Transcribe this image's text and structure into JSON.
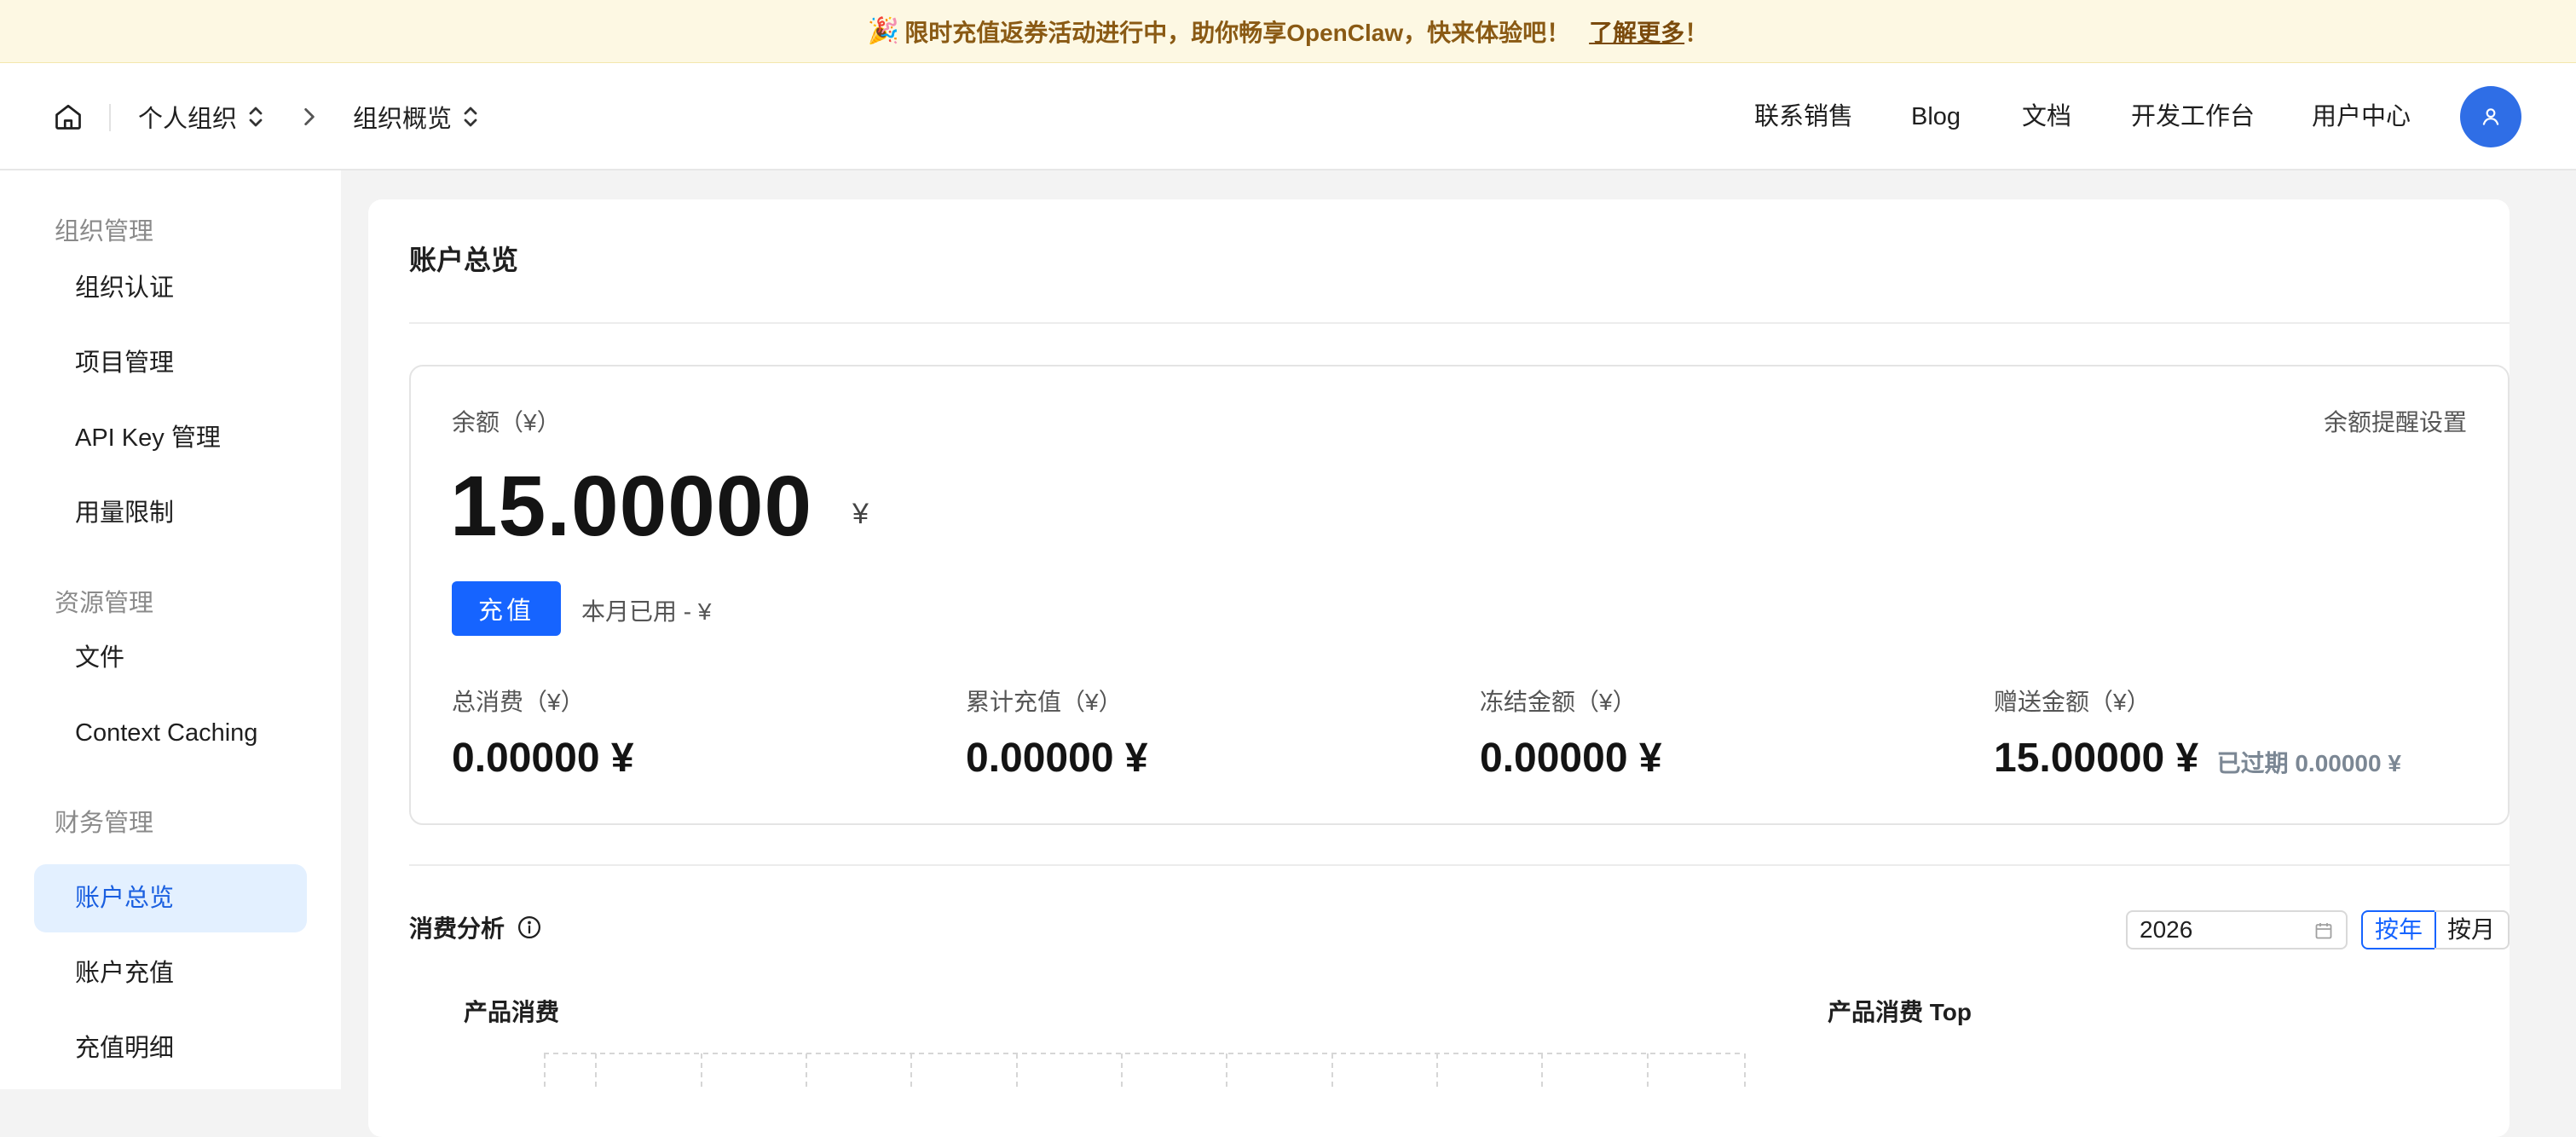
{
  "banner": {
    "icon": "party-popper-icon",
    "text": "限时充值返券活动进行中，助你畅享OpenClaw，快来体验吧！",
    "link": "了解更多",
    "tail": "！"
  },
  "nav": {
    "org": "个人组织",
    "page": "组织概览",
    "links": [
      "联系销售",
      "Blog",
      "文档",
      "开发工作台",
      "用户中心"
    ]
  },
  "sidebar": {
    "groups": [
      {
        "title": "组织管理",
        "items": [
          "组织认证",
          "项目管理",
          "API Key 管理",
          "用量限制"
        ]
      },
      {
        "title": "资源管理",
        "items": [
          "文件",
          "Context Caching"
        ]
      },
      {
        "title": "财务管理",
        "items": [
          "账户总览",
          "账户充值",
          "充值明细"
        ]
      }
    ],
    "active": "账户总览"
  },
  "main": {
    "title": "账户总览",
    "balance": {
      "label": "余额（¥）",
      "remind": "余额提醒设置",
      "amount": "15.00000",
      "unit": "¥",
      "recharge": "充值",
      "month_used": "本月已用 - ¥"
    },
    "stats": [
      {
        "label": "总消费（¥）",
        "value": "0.00000 ¥"
      },
      {
        "label": "累计充值（¥）",
        "value": "0.00000 ¥"
      },
      {
        "label": "冻结金额（¥）",
        "value": "0.00000 ¥"
      },
      {
        "label": "赠送金额（¥）",
        "value": "15.00000 ¥",
        "extra": "已过期 0.00000 ¥"
      }
    ],
    "analysis": {
      "title": "消费分析",
      "year": "2026",
      "by_year": "按年",
      "by_month": "按月",
      "chart_left": "产品消费",
      "chart_right": "产品消费 Top"
    }
  },
  "colors": {
    "primary": "#1664ff",
    "active_bg": "#e3f0ff",
    "banner_bg": "#fdf8e3",
    "banner_text": "#8a5a14",
    "avatar": "#2f6ee6"
  }
}
